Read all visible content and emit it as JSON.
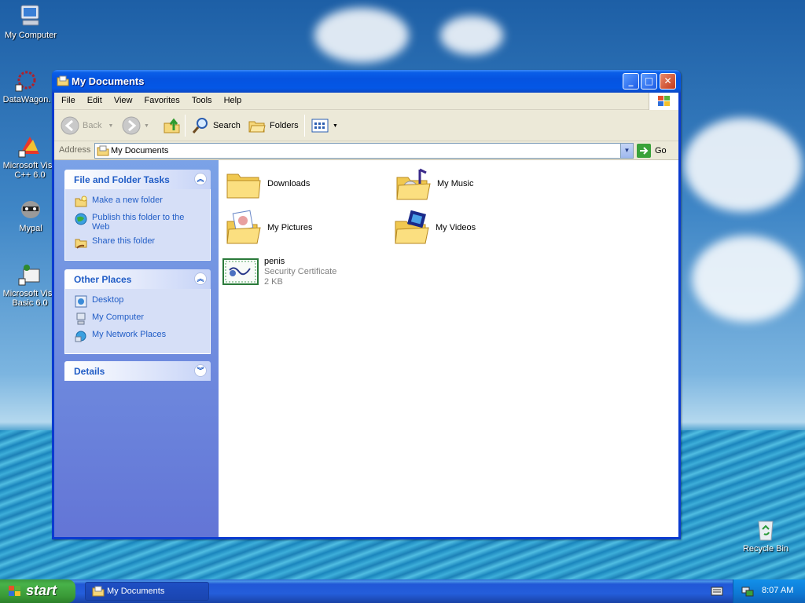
{
  "desktop": {
    "icons": [
      {
        "label": "My Computer"
      },
      {
        "label": "DataWagon."
      },
      {
        "label": "Microsoft Visu C++ 6.0"
      },
      {
        "label": "Mypal"
      },
      {
        "label": "Microsoft Visu Basic 6.0"
      },
      {
        "label": "Recycle Bin"
      }
    ]
  },
  "window": {
    "title": "My Documents",
    "menu": [
      "File",
      "Edit",
      "View",
      "Favorites",
      "Tools",
      "Help"
    ],
    "toolbar": {
      "back": "Back",
      "search": "Search",
      "folders": "Folders"
    },
    "address": {
      "label": "Address",
      "value": "My Documents",
      "go": "Go"
    },
    "taskpane": {
      "file_tasks": {
        "title": "File and Folder Tasks",
        "items": [
          "Make a new folder",
          "Publish this folder to the Web",
          "Share this folder"
        ]
      },
      "other_places": {
        "title": "Other Places",
        "items": [
          "Desktop",
          "My Computer",
          "My Network Places"
        ]
      },
      "details": {
        "title": "Details"
      }
    },
    "items": [
      {
        "name": "Downloads"
      },
      {
        "name": "My Music"
      },
      {
        "name": "My Pictures"
      },
      {
        "name": "My Videos"
      },
      {
        "name": "penis",
        "type": "Security Certificate",
        "size": "2 KB"
      }
    ]
  },
  "taskbar": {
    "start": "start",
    "task": "My Documents",
    "clock": "8:07 AM"
  }
}
